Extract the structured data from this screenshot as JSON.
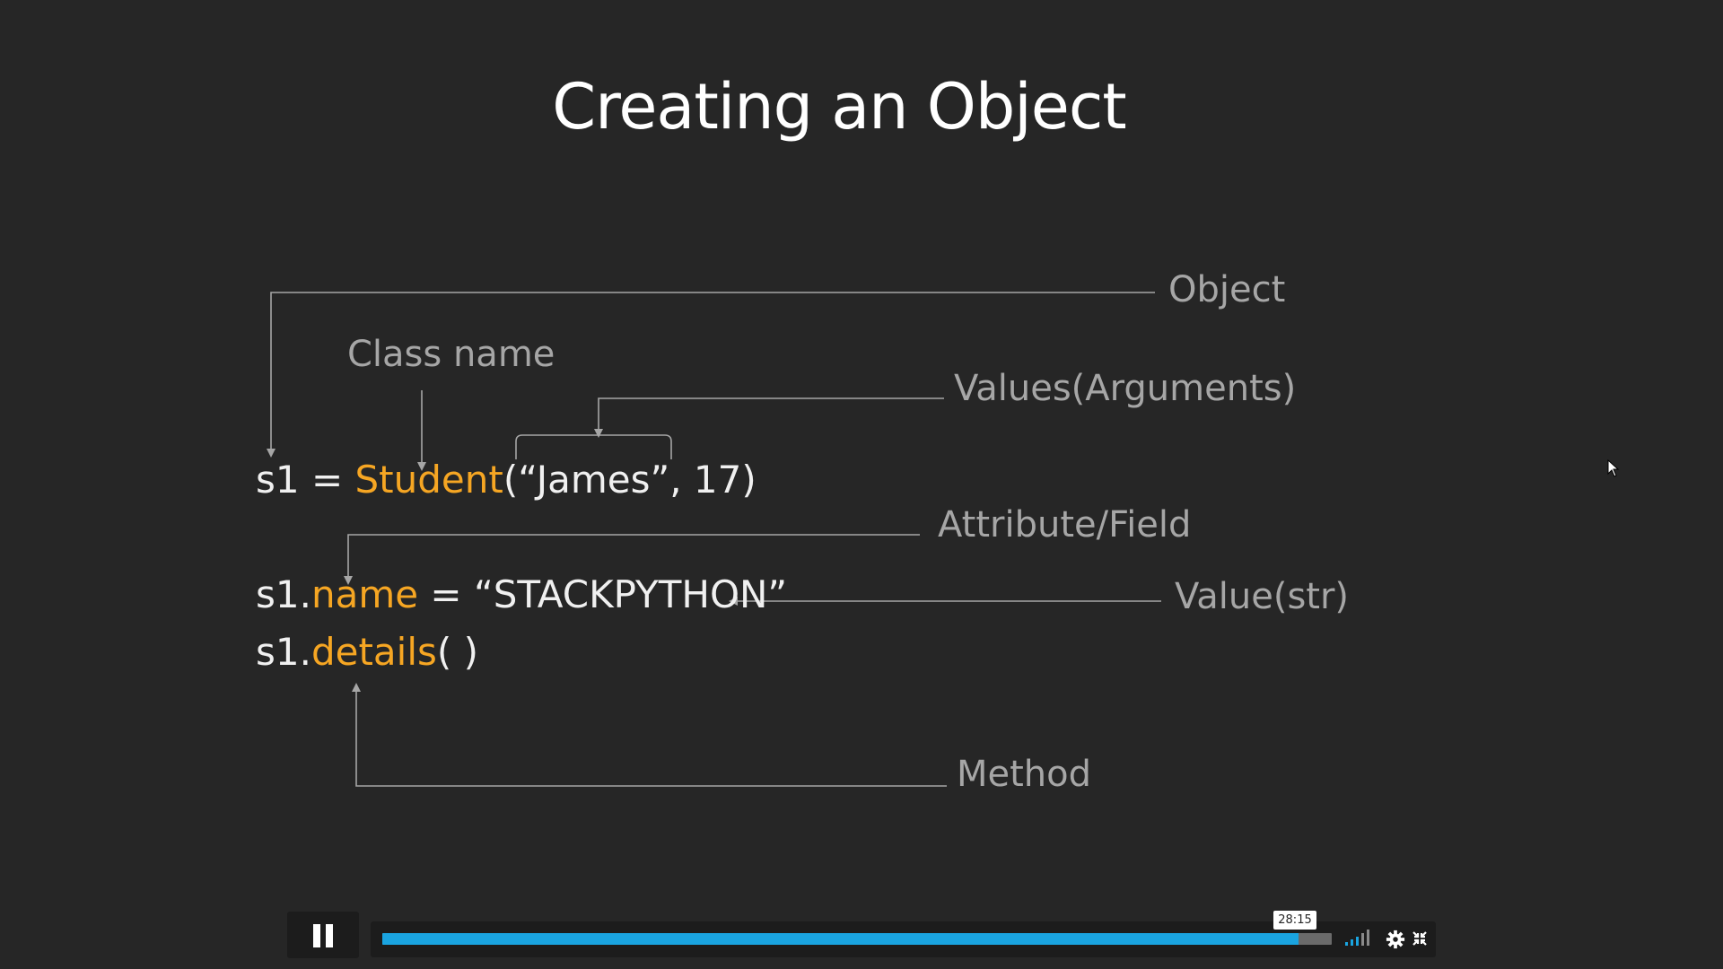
{
  "slide": {
    "title": "Creating an Object",
    "labels": {
      "object": "Object",
      "class_name": "Class name",
      "values": "Values(Arguments)",
      "attribute": "Attribute/Field",
      "value_str": "Value(str)",
      "method": "Method"
    },
    "code": {
      "line1": {
        "var": "s1 = ",
        "class": "Student",
        "args": "(“James”, 17)"
      },
      "line2": {
        "prefix": "s1.",
        "attr": "name",
        "rest": " = “STACKPYTHON”"
      },
      "line3": {
        "prefix": "s1.",
        "method": "details",
        "rest": "( )"
      }
    },
    "colors": {
      "background": "#262626",
      "accent": "#f6a623",
      "label": "#a6a6a6",
      "code": "#f0f0f0"
    }
  },
  "player": {
    "time_tooltip": "28:15",
    "progress": 0.965,
    "icons": [
      "pause-icon",
      "volume-icon",
      "gear-icon",
      "fullscreen-icon"
    ],
    "progress_color": "#1aa4e0"
  }
}
